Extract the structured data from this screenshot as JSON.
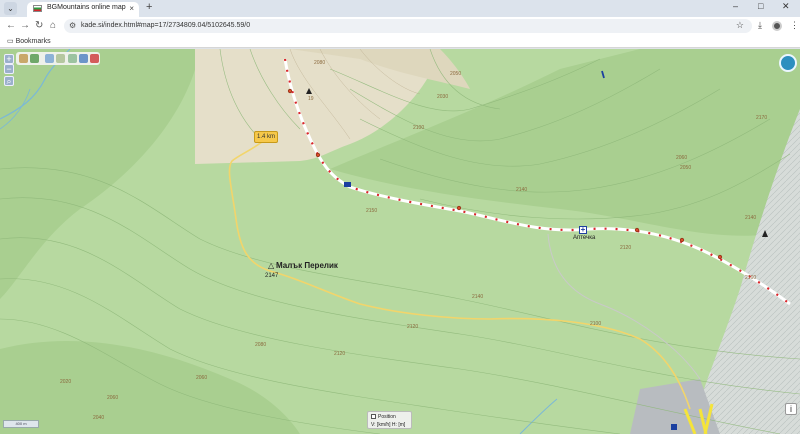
{
  "browser": {
    "tab_title": "BGMountains online map",
    "tab_close": "×",
    "new_tab": "+",
    "url": "kade.si/index.html#map=17/2734809.04/5102645.59/0",
    "bookmarks_label": "Bookmarks",
    "window_controls": [
      "–",
      "□",
      "✕"
    ]
  },
  "map": {
    "distance_label": "1.4 km",
    "peak_name": "Малък Перелик",
    "peak_elevation": "2147",
    "first_aid_label": "Аптечка",
    "contour_labels": [
      "2080",
      "2050",
      "2030",
      "2100",
      "2140",
      "2150",
      "2120",
      "2140",
      "2120",
      "2120",
      "2060",
      "2050",
      "2140",
      "2170",
      "2160",
      "2100",
      "2080",
      "2060",
      "2060",
      "2040",
      "2020",
      "19"
    ],
    "zoom_in": "+",
    "zoom_out": "−",
    "scale_label": "400 m",
    "position_label": "Position",
    "position_row": "V:   [km/h]   H:   [m]",
    "info_glyph": "i"
  },
  "colors": {
    "meadow": "#b7d9a0",
    "meadow_dark": "#a9cf90",
    "bare_ground": "#e5dfc9",
    "rock_pattern": "#d3d8d6",
    "trail_red": "#d9262b",
    "road_yellow": "#f2d56b",
    "accent_blue": "#2d8fbf"
  }
}
